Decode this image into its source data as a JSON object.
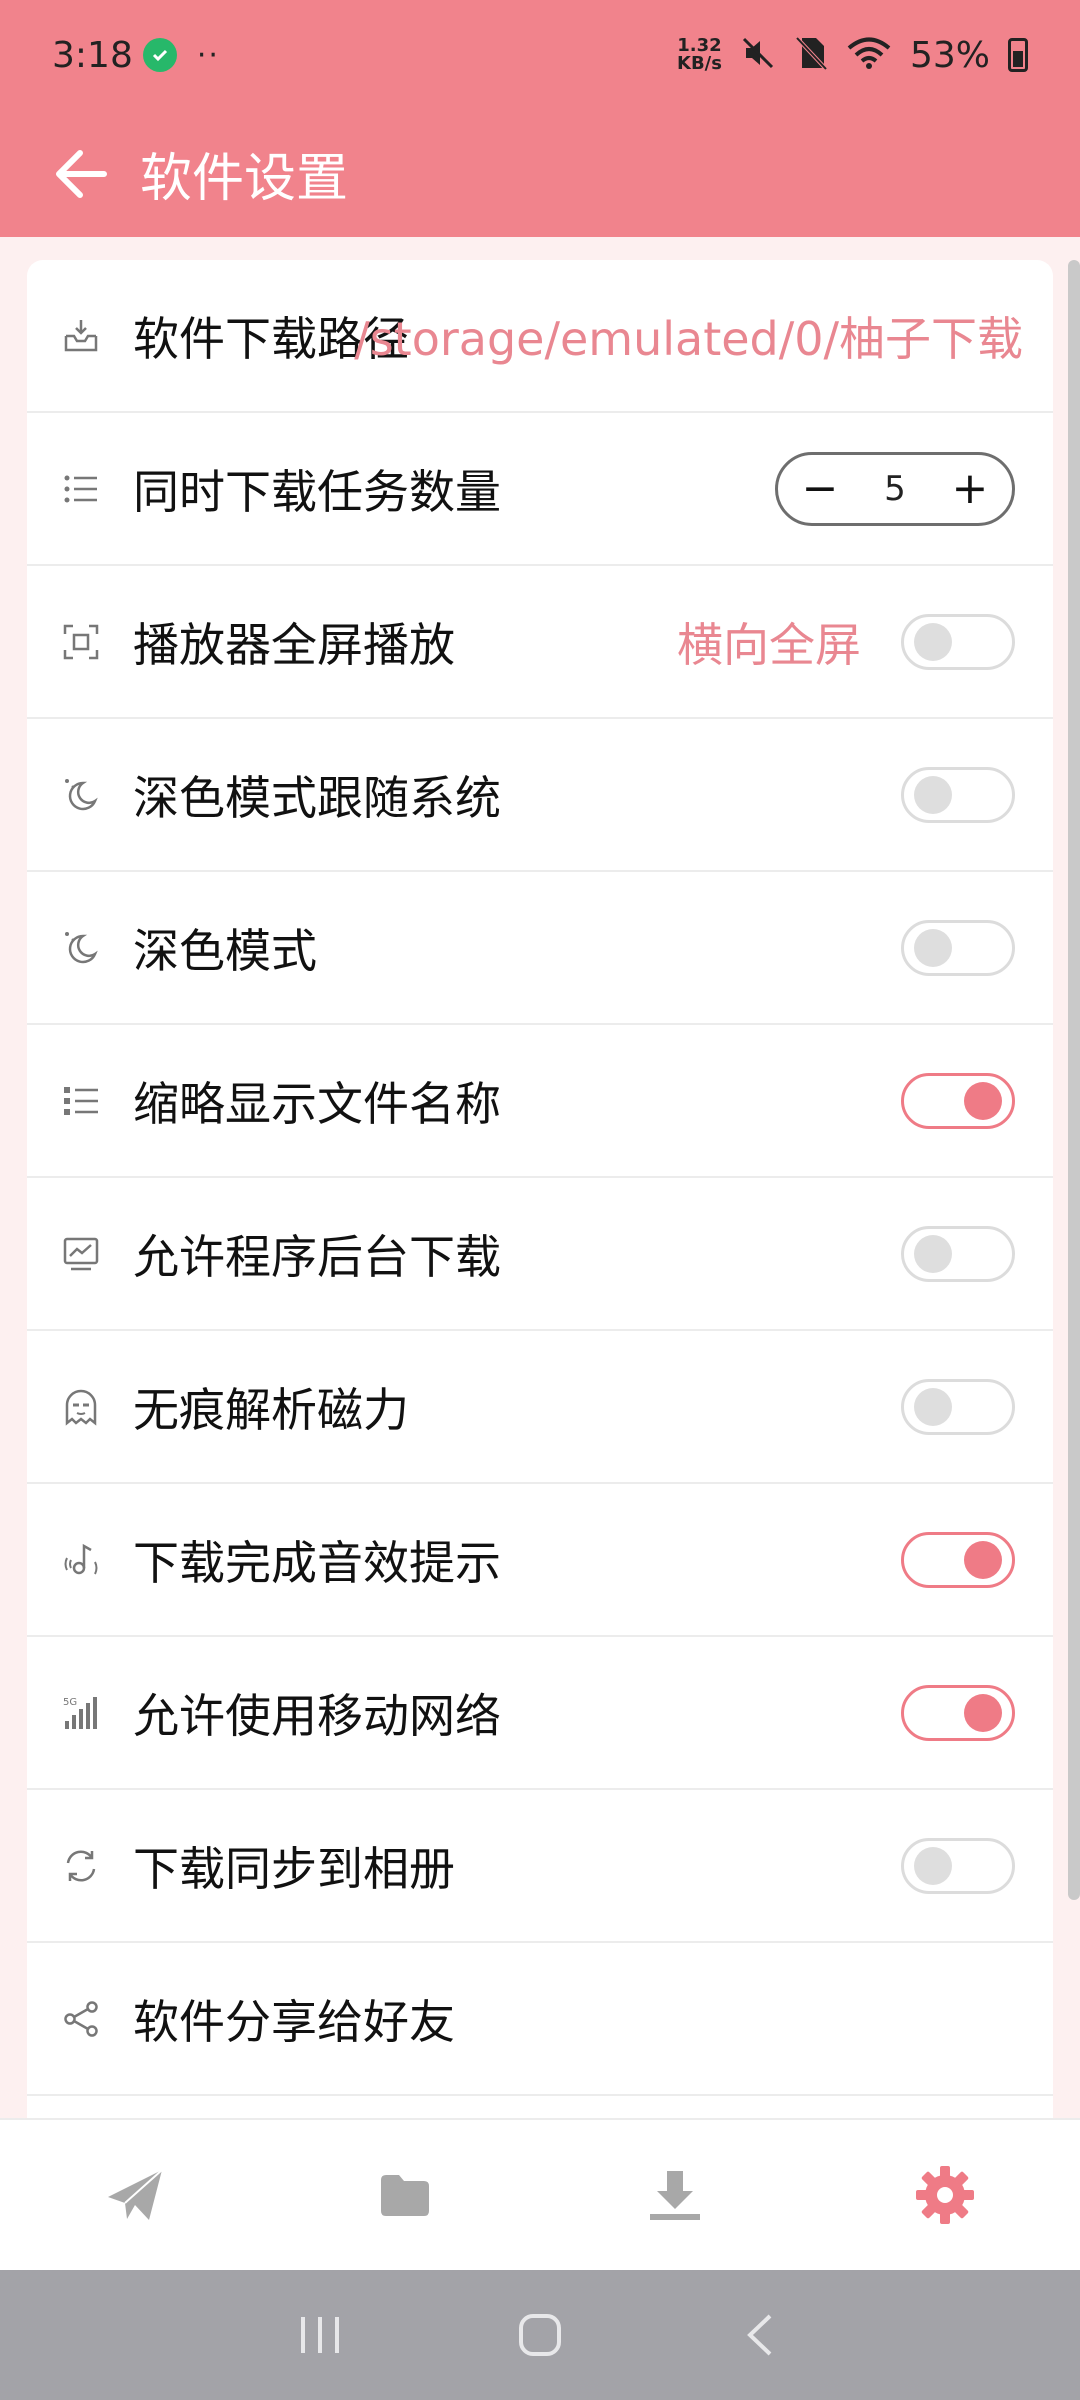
{
  "status_bar": {
    "time": "3:18",
    "dots": "··",
    "speed_top": "1.32",
    "speed_bottom": "KB/s",
    "battery": "53%"
  },
  "header": {
    "title": "软件设置"
  },
  "settings": {
    "download_path": {
      "label": "软件下载路径",
      "value": "/storage/emulated/0/柚子下载"
    },
    "concurrent": {
      "label": "同时下载任务数量",
      "value": "5",
      "minus": "−",
      "plus": "+"
    },
    "fullscreen": {
      "label": "播放器全屏播放",
      "value": "横向全屏",
      "on": false
    },
    "dark_follow": {
      "label": "深色模式跟随系统",
      "on": false
    },
    "dark_mode": {
      "label": "深色模式",
      "on": false
    },
    "abbrev": {
      "label": "缩略显示文件名称",
      "on": true
    },
    "background": {
      "label": "允许程序后台下载",
      "on": false
    },
    "incognito": {
      "label": "无痕解析磁力",
      "on": false
    },
    "sound": {
      "label": "下载完成音效提示",
      "on": true
    },
    "mobile": {
      "label": "允许使用移动网络",
      "on": true
    },
    "sync_album": {
      "label": "下载同步到相册",
      "on": false
    },
    "share": {
      "label": "软件分享给好友"
    }
  },
  "bottom_nav": {
    "items": [
      {
        "icon": "paper-plane-icon",
        "active": false
      },
      {
        "icon": "folder-icon",
        "active": false
      },
      {
        "icon": "download-icon",
        "active": false
      },
      {
        "icon": "gear-icon",
        "active": true
      }
    ]
  },
  "colors": {
    "accent": "#f1838c",
    "toggle_on": "#ef7b86",
    "accent_text": "#e98791"
  }
}
